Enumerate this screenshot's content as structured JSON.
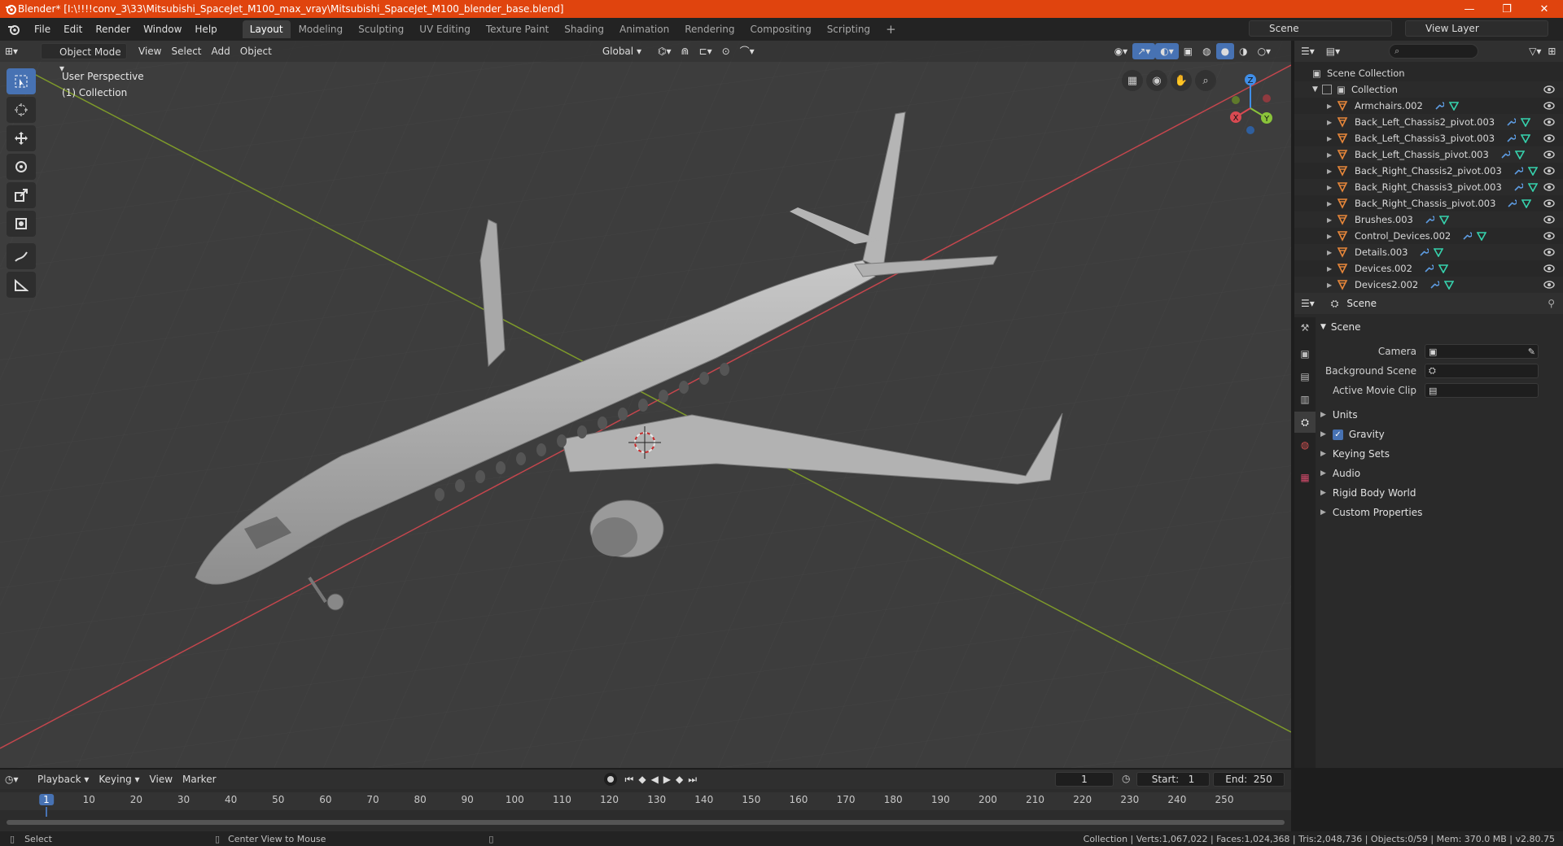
{
  "window": {
    "title": "Blender* [I:\\!!!!conv_3\\33\\Mitsubishi_SpaceJet_M100_max_vray\\Mitsubishi_SpaceJet_M100_blender_base.blend]",
    "min": "—",
    "max": "❐",
    "close": "✕"
  },
  "menu": [
    "File",
    "Edit",
    "Render",
    "Window",
    "Help"
  ],
  "workspaces": [
    "Layout",
    "Modeling",
    "Sculpting",
    "UV Editing",
    "Texture Paint",
    "Shading",
    "Animation",
    "Rendering",
    "Compositing",
    "Scripting"
  ],
  "workspace_add": "+",
  "scene_selector": "Scene",
  "view_layer": "View Layer",
  "viewport": {
    "mode": "Object Mode",
    "menus": [
      "View",
      "Select",
      "Add",
      "Object"
    ],
    "transform_orientation": "Global",
    "info_line1": "User Perspective",
    "info_line2": "(1) Collection",
    "gizmo": {
      "x": "X",
      "y": "Y",
      "z": "Z"
    }
  },
  "outliner": {
    "scene_collection": "Scene Collection",
    "collection": "Collection",
    "items": [
      "Armchairs.002",
      "Back_Left_Chassis2_pivot.003",
      "Back_Left_Chassis3_pivot.003",
      "Back_Left_Chassis_pivot.003",
      "Back_Right_Chassis2_pivot.003",
      "Back_Right_Chassis3_pivot.003",
      "Back_Right_Chassis_pivot.003",
      "Brushes.003",
      "Control_Devices.002",
      "Details.003",
      "Devices.002",
      "Devices2.002"
    ]
  },
  "properties": {
    "context": "Scene",
    "panel_title": "Scene",
    "camera_label": "Camera",
    "background_scene_label": "Background Scene",
    "active_movie_clip_label": "Active Movie Clip",
    "subpanels": [
      "Units",
      "Gravity",
      "Keying Sets",
      "Audio",
      "Rigid Body World",
      "Custom Properties"
    ]
  },
  "timeline": {
    "menus": [
      "Playback",
      "Keying",
      "View",
      "Marker"
    ],
    "current_frame": "1",
    "start_label": "Start:",
    "start": "1",
    "end_label": "End:",
    "end": "250",
    "ticks": [
      "1",
      "10",
      "20",
      "30",
      "40",
      "50",
      "60",
      "70",
      "80",
      "90",
      "100",
      "110",
      "120",
      "130",
      "140",
      "150",
      "160",
      "170",
      "180",
      "190",
      "200",
      "210",
      "220",
      "230",
      "240",
      "250"
    ]
  },
  "status": {
    "select": "Select",
    "center_view": "Center View to Mouse",
    "stats": "Collection | Verts:1,067,022 | Faces:1,024,368 | Tris:2,048,736 | Objects:0/59 | Mem: 370.0 MB | v2.80.75"
  },
  "colors": {
    "titlebar": "#e0440e",
    "accent": "#4772b3",
    "x_axis": "#d94a52",
    "y_axis": "#8ac43a",
    "z_axis": "#3f8ee8",
    "object_icon": "#e8873a",
    "modifier_icon": "#5d9be0",
    "mesh_icon": "#36d2ad"
  }
}
